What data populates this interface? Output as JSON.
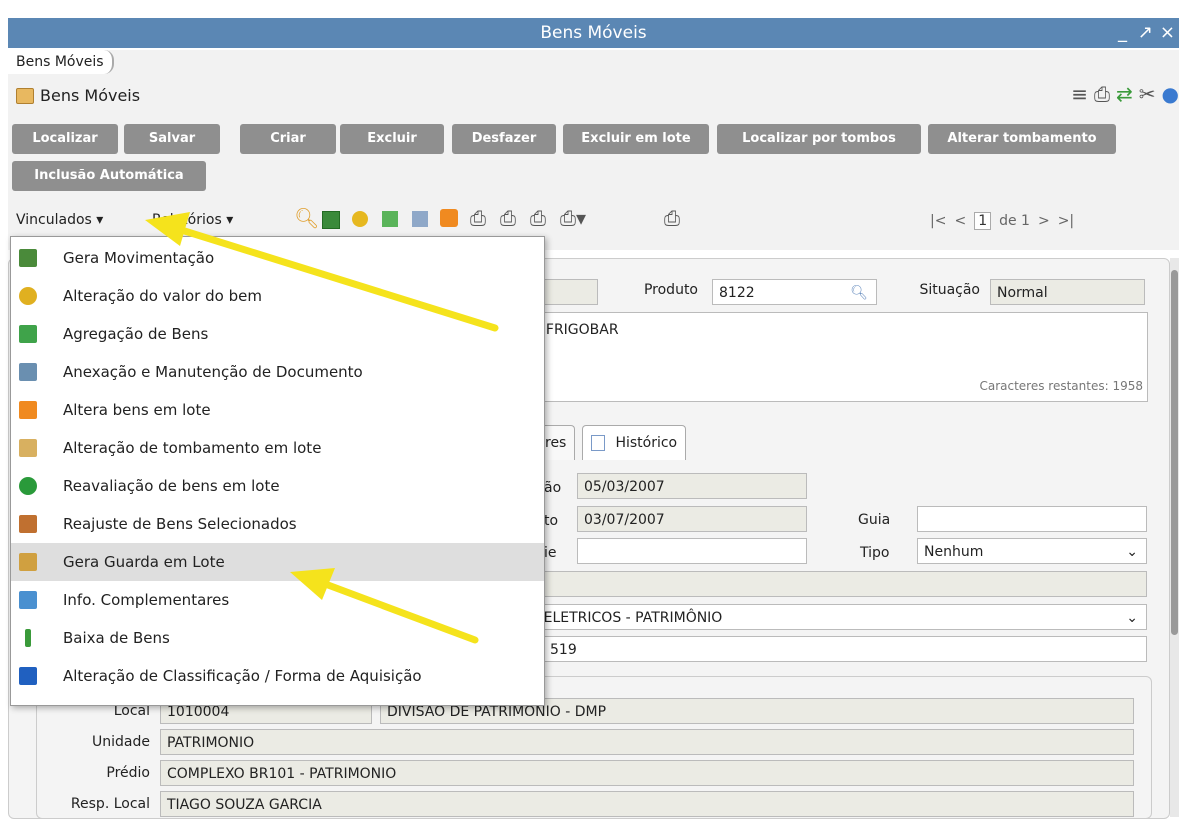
{
  "window": {
    "title": "Bens Móveis",
    "controls": [
      "_",
      "↗",
      "×"
    ]
  },
  "breadcrumb": "Bens Móveis",
  "page_title": "Bens Móveis",
  "buttons": [
    {
      "label": "Localizar"
    },
    {
      "label": "Salvar"
    },
    {
      "label": "Criar"
    },
    {
      "label": "Excluir"
    },
    {
      "label": "Desfazer"
    },
    {
      "label": "Excluir em lote"
    },
    {
      "label": "Localizar por tombos"
    },
    {
      "label": "Alterar tombamento"
    },
    {
      "label": "Inclusão Automática"
    }
  ],
  "toolbar": {
    "vinculados": "Vinculados ▾",
    "relatorios": "Relatórios ▾"
  },
  "pager": {
    "first": "|<",
    "prev": "<",
    "page": "1",
    "of": "de 1",
    "next": ">",
    "last": ">|"
  },
  "menu": [
    {
      "label": "Gera Movimentação",
      "color": "#4a8a3a"
    },
    {
      "label": "Alteração do valor do bem",
      "color": "#e0b020"
    },
    {
      "label": "Agregação de Bens",
      "color": "#3fa34a"
    },
    {
      "label": "Anexação e Manutenção de Documento",
      "color": "#6a8fb0"
    },
    {
      "label": "Altera bens em lote",
      "color": "#f08a20"
    },
    {
      "label": "Alteração de tombamento em lote",
      "color": "#d8b060"
    },
    {
      "label": "Reavaliação de bens em lote",
      "color": "#2a9a3a"
    },
    {
      "label": "Reajuste de Bens Selecionados",
      "color": "#c07030"
    },
    {
      "label": "Gera Guarda em Lote",
      "color": "#d0a040"
    },
    {
      "label": "Info. Complementares",
      "color": "#4a90d0"
    },
    {
      "label": "Baixa de Bens",
      "color": "#3a9a3a"
    },
    {
      "label": "Alteração de Classificação / Forma de Aquisição",
      "color": "#2060c0"
    }
  ],
  "form": {
    "produto_label": "Produto",
    "produto_value": "8122",
    "situacao_label": "Situação",
    "situacao_value": "Normal",
    "descricao": ", FRIGOBAR",
    "chars_left": "Caracteres restantes: 1958",
    "tab_partial": "res",
    "tab_historico": "Histórico",
    "lbl_data1_partial": "ão",
    "data1": "05/03/2007",
    "lbl_data2_partial": "to",
    "data2": "03/07/2007",
    "guia_label": "Guia",
    "guia_value": "",
    "lbl_serie_partial": "ie",
    "serie_value": "",
    "tipo_label": "Tipo",
    "tipo_value": "Nenhum",
    "classif_value": "S E ELETRICOS - PATRIMÔNIO",
    "num_value": "519",
    "local_label": "Local",
    "local_code": "1010004",
    "local_name": "DIVISAO DE PATRIMONIO - DMP",
    "unidade_label": "Unidade",
    "unidade_value": "PATRIMONIO",
    "predio_label": "Prédio",
    "predio_value": "COMPLEXO BR101 - PATRIMONIO",
    "resp_label": "Resp. Local",
    "resp_value": "TIAGO SOUZA GARCIA"
  }
}
